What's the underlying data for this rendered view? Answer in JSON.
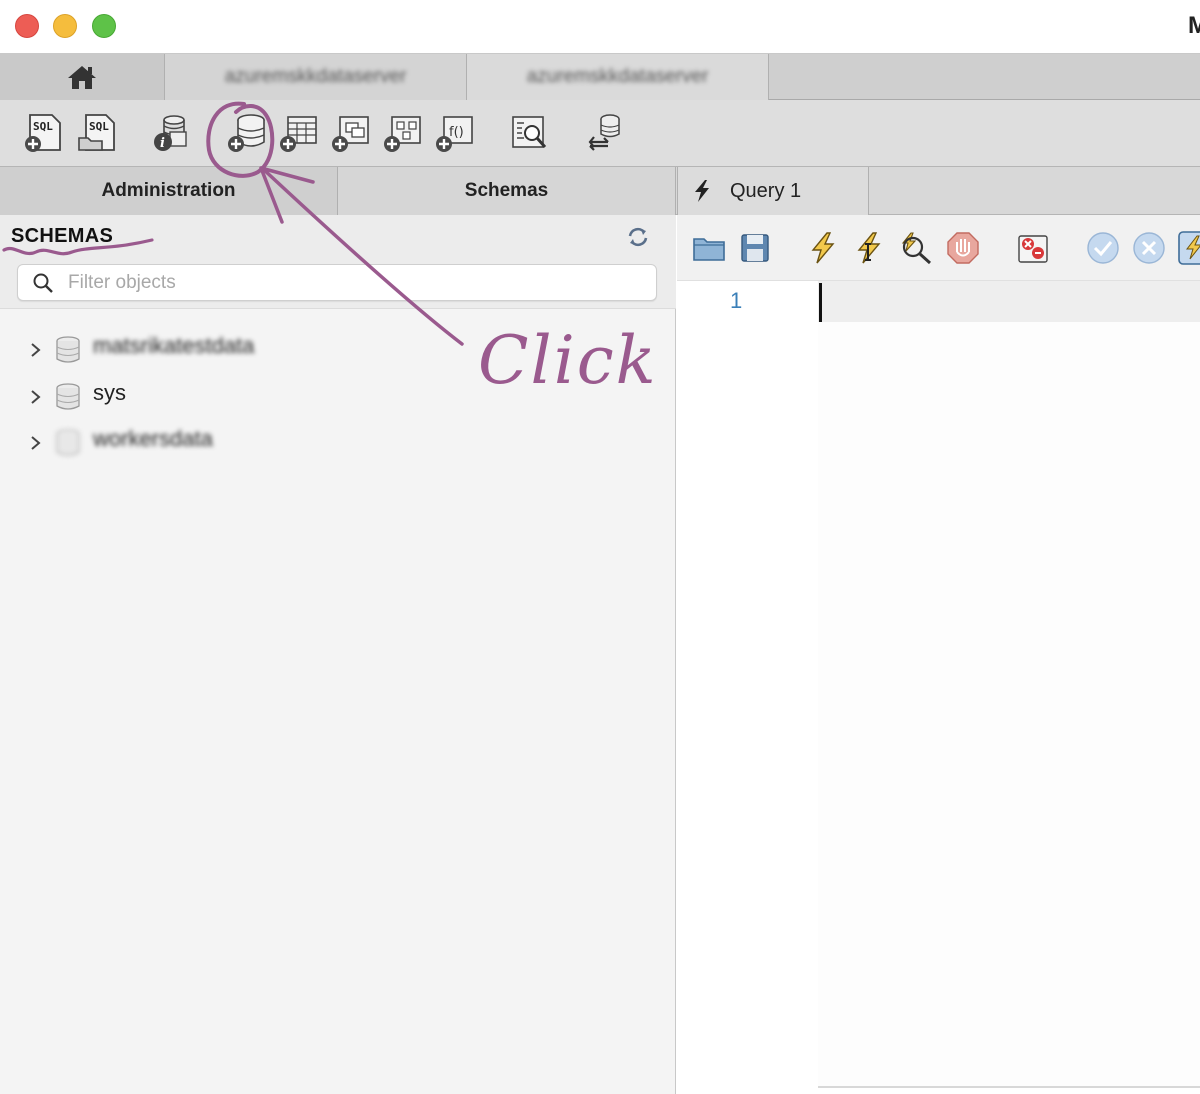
{
  "window": {
    "title_partial": "M",
    "traffic_lights": [
      "close",
      "minimize",
      "zoom"
    ]
  },
  "connection_tabs": {
    "home_icon": "home-icon",
    "tabs": [
      {
        "label": "azuremskkdataserver"
      },
      {
        "label": "azuremskkdataserver"
      }
    ]
  },
  "toolbar": {
    "buttons": [
      {
        "icon": "new-sql-tab-icon",
        "text": "SQL"
      },
      {
        "icon": "open-sql-script-icon",
        "text": "SQL"
      },
      {
        "icon": "schema-inspector-icon"
      },
      {
        "icon": "create-schema-icon"
      },
      {
        "icon": "create-table-icon"
      },
      {
        "icon": "create-view-icon"
      },
      {
        "icon": "create-stored-procedure-icon"
      },
      {
        "icon": "create-function-icon",
        "text": "f()"
      },
      {
        "icon": "search-table-data-icon"
      },
      {
        "icon": "reconnect-dbms-icon"
      }
    ]
  },
  "sections": {
    "administration": "Administration",
    "schemas": "Schemas",
    "query_tab": "Query 1"
  },
  "sidebar": {
    "title": "SCHEMAS",
    "filter_placeholder": "Filter objects",
    "filter_value": "",
    "items": [
      {
        "label": "matsrikatestdata",
        "blurred": true
      },
      {
        "label": "sys",
        "blurred": false
      },
      {
        "label": "workersdata",
        "blurred": true
      }
    ]
  },
  "editor": {
    "line_numbers": [
      "1"
    ],
    "content": ""
  },
  "annotation": {
    "text": "Click",
    "color": "#9a5a8e"
  }
}
